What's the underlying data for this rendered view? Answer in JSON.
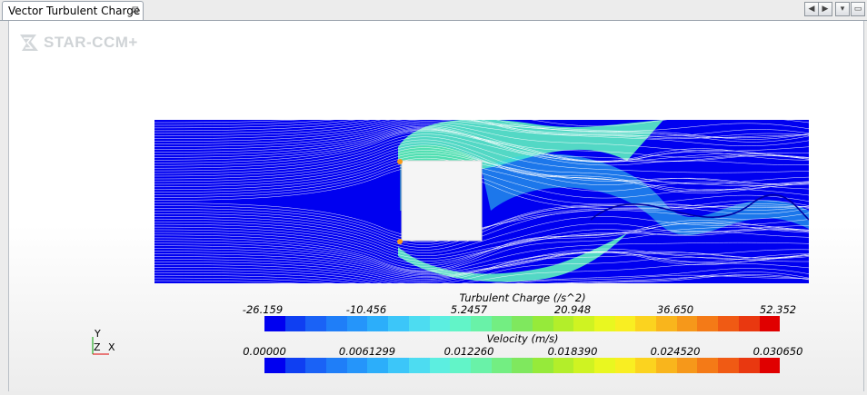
{
  "tab": {
    "title": "Vector Turbulent Charge",
    "close_glyph": "⊠"
  },
  "window_controls": {
    "prev_glyph": "◀",
    "next_glyph": "▶",
    "menu_glyph": "▾",
    "max_glyph": "▭"
  },
  "logo": {
    "text": "STAR-CCM+"
  },
  "legends": [
    {
      "title": "Turbulent Charge (/s^2)",
      "ticks": [
        "-26.159",
        "-10.456",
        "5.2457",
        "20.948",
        "36.650",
        "52.352"
      ]
    },
    {
      "title": "Velocity (m/s)",
      "ticks": [
        "0.00000",
        "0.0061299",
        "0.012260",
        "0.018390",
        "0.024520",
        "0.030650"
      ]
    }
  ],
  "colormap": [
    "#0000f0",
    "#0f3ff2",
    "#1a62f6",
    "#1f7ef8",
    "#2595fa",
    "#2caefa",
    "#3cc6f9",
    "#4ddcf1",
    "#5ceee0",
    "#62f4c8",
    "#69f2a8",
    "#73ee82",
    "#7fe85e",
    "#96ea3a",
    "#b3ee2a",
    "#cff322",
    "#e9f720",
    "#f9ee22",
    "#fbd31f",
    "#f9b51c",
    "#f6981a",
    "#f47a17",
    "#f05a14",
    "#e93810",
    "#e00000"
  ],
  "axes": {
    "y": "Y",
    "z": "Z",
    "x": "X"
  }
}
